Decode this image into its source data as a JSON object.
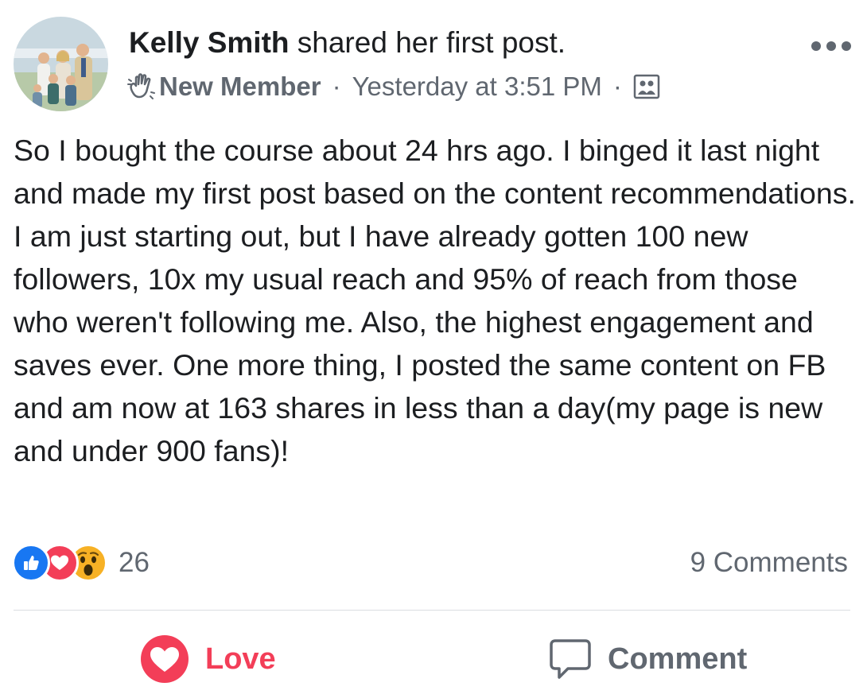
{
  "post": {
    "author_name": "Kelly Smith",
    "action_text": "shared her first post.",
    "badge": "New Member",
    "separator": "·",
    "timestamp": "Yesterday at 3:51 PM",
    "privacy_icon": "group-photo-icon",
    "badge_icon": "waving-hand-icon",
    "body": "So I bought the course about 24 hrs ago. I binged it last night and made my first post based on the content recommendations. I am just starting out, but I have already gotten 100 new followers, 10x my usual reach and 95% of reach from those who weren't following me. Also, the highest engagement and saves ever. One more thing, I posted the same content on FB and am now at 163 shares in less than a day(my page is new and under 900 fans)!"
  },
  "reactions": {
    "types": [
      "like",
      "love",
      "wow"
    ],
    "count": "26",
    "comments_label": "9 Comments"
  },
  "actions": {
    "love_label": "Love",
    "comment_label": "Comment"
  },
  "colors": {
    "primary_text": "#1c1e21",
    "secondary_text": "#606770",
    "love": "#f33e58",
    "like": "#1877f2",
    "wow": "#f7b125"
  }
}
